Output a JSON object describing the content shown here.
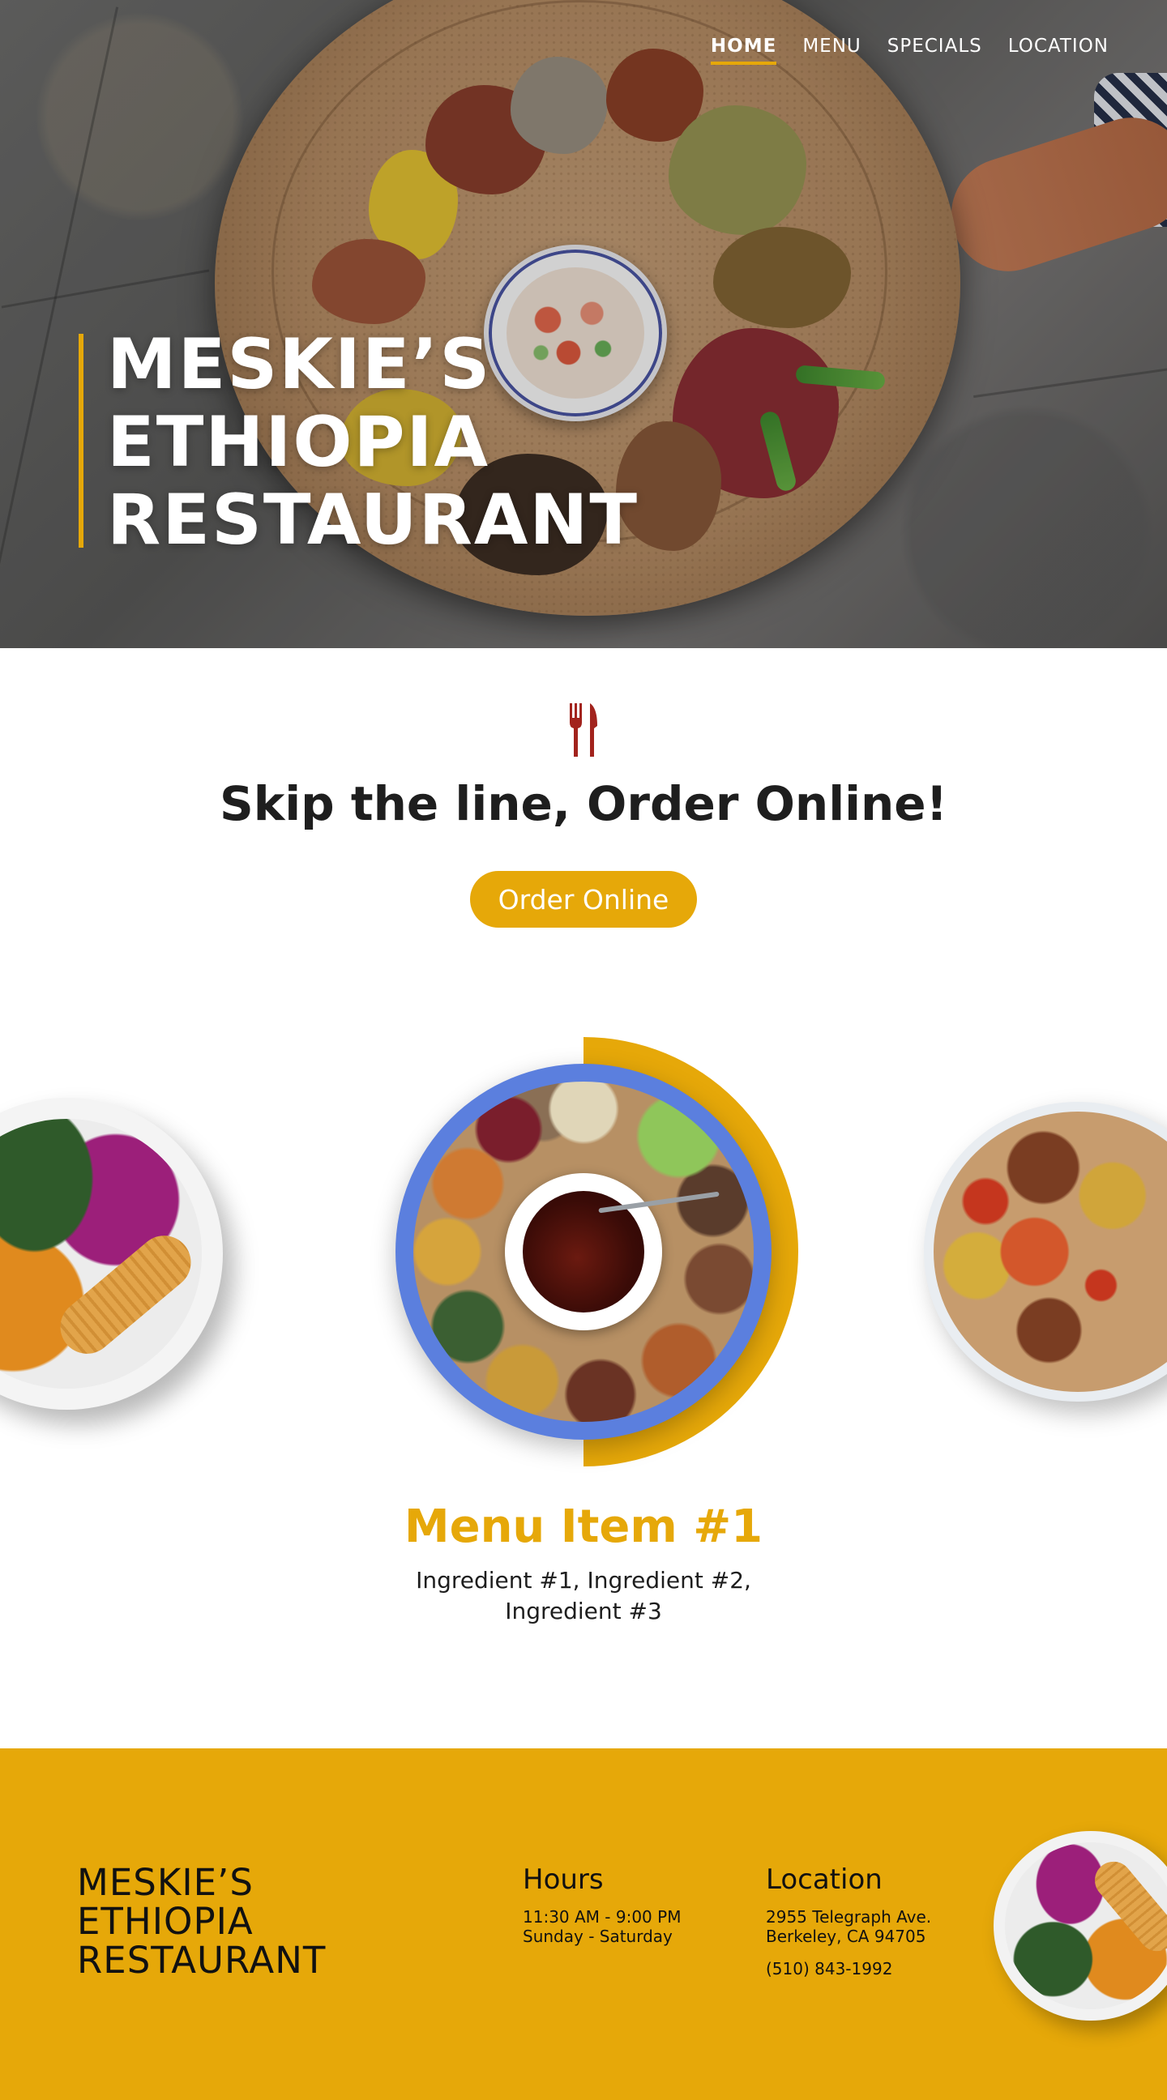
{
  "nav": {
    "items": [
      {
        "label": "HOME",
        "active": true
      },
      {
        "label": "MENU",
        "active": false
      },
      {
        "label": "SPECIALS",
        "active": false
      },
      {
        "label": "LOCATION",
        "active": false
      }
    ]
  },
  "hero": {
    "title_lines": [
      "MESKIE’S",
      "ETHIOPIA",
      "RESTAURANT"
    ]
  },
  "order": {
    "icon": "utensils-icon",
    "heading": "Skip the line, Order Online!",
    "button_label": "Order Online"
  },
  "carousel": {
    "active_item": {
      "title": "Menu Item #1",
      "ingredients": "Ingredient #1, Ingredient #2, Ingredient #3"
    }
  },
  "footer": {
    "brand_lines": [
      "MESKIE’S",
      "ETHIOPIA",
      "RESTAURANT"
    ],
    "hours": {
      "heading": "Hours",
      "time": "11:30 AM - 9:00 PM",
      "days": "Sunday - Saturday"
    },
    "location": {
      "heading": "Location",
      "street": "2955 Telegraph Ave.",
      "city": "Berkeley, CA 94705",
      "phone": "(510) 843-1992"
    }
  },
  "colors": {
    "accent": "#e6a809",
    "icon_red": "#a2231d",
    "text_dark": "#1e1e1e",
    "white": "#ffffff"
  }
}
